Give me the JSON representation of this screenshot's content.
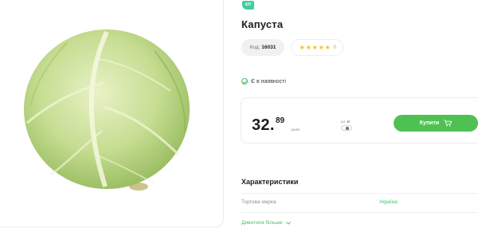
{
  "product": {
    "badge": "хіт",
    "title": "Капуста",
    "code_label": "Код:",
    "code_value": "16031",
    "rating": 5,
    "rating_count": "0",
    "stock_status": "Є в наявності"
  },
  "price": {
    "integer": "32.",
    "fraction": "89",
    "unit": "грн/кг"
  },
  "unit_switch": {
    "options": [
      "шт",
      "кг"
    ],
    "selected": "кг"
  },
  "buy_button": {
    "label": "Купити"
  },
  "characteristics": {
    "title": "Характеристики",
    "rows": [
      {
        "key": "Торгова марка",
        "value": "Україна"
      }
    ],
    "see_more_label": "Дивитися більше"
  },
  "colors": {
    "accent_green": "#4fc152",
    "badge_teal": "#3fcf9c",
    "star_yellow": "#f5c417"
  },
  "icons": [
    "cabbage-image",
    "star-icon",
    "check-circle-icon",
    "cart-icon",
    "chevron-down-icon"
  ]
}
